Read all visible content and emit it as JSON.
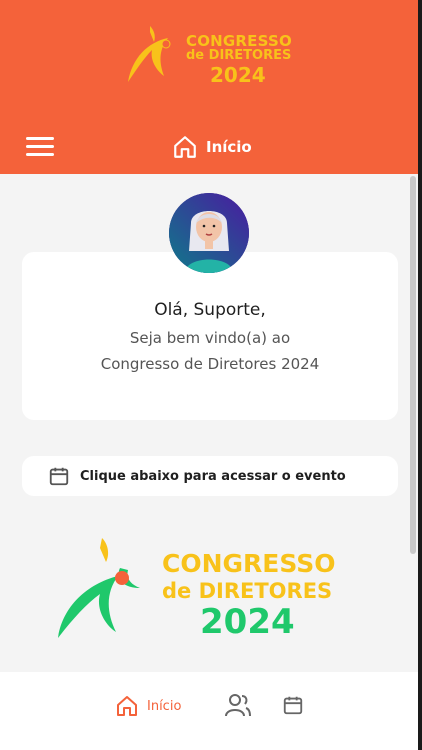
{
  "header": {
    "logo": {
      "line1": "CONGRESSO",
      "line2": "de DIRETORES",
      "line3": "2024"
    },
    "title": "Início",
    "menu_icon": "menu-icon",
    "title_icon": "home-icon"
  },
  "welcome": {
    "greeting": "Olá, Suporte,",
    "line1": "Seja bem vindo(a) ao",
    "line2": "Congresso de Diretores 2024"
  },
  "cta": {
    "icon": "calendar-icon",
    "label": "Clique abaixo para acessar o evento"
  },
  "banner": {
    "line1": "CONGRESSO",
    "line2": "de DIRETORES",
    "line3": "2024"
  },
  "bottom_nav": {
    "home_label": "Início",
    "home_icon": "home-icon",
    "people_icon": "people-icon",
    "calendar_icon": "calendar-icon"
  },
  "colors": {
    "brand_orange": "#f4623a",
    "logo_yellow": "#f8c21a",
    "banner_green": "#1fc86b",
    "background": "#f4f4f4"
  }
}
